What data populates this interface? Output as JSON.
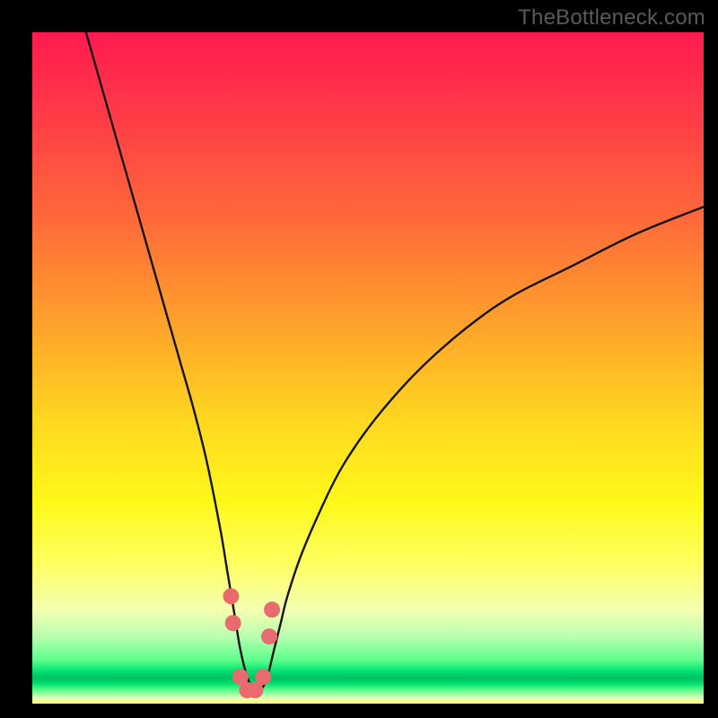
{
  "watermark": "TheBottleneck.com",
  "chart_data": {
    "type": "line",
    "title": "",
    "xlabel": "",
    "ylabel": "",
    "xlim": [
      0,
      100
    ],
    "ylim": [
      0,
      100
    ],
    "series": [
      {
        "name": "bottleneck-curve",
        "x": [
          8,
          10,
          12,
          14,
          16,
          18,
          20,
          22,
          24,
          26,
          28,
          29,
          30,
          31,
          32,
          33,
          34,
          35,
          36,
          37,
          38,
          40,
          43,
          46,
          50,
          55,
          60,
          66,
          72,
          80,
          90,
          100
        ],
        "y": [
          100,
          93,
          86,
          79,
          72,
          65,
          58,
          51,
          44,
          36,
          26,
          20,
          14,
          8,
          4,
          2,
          2,
          4,
          8,
          12,
          16,
          22,
          29,
          35,
          41,
          47,
          52,
          57,
          61,
          65,
          70,
          74
        ]
      }
    ],
    "markers": {
      "name": "highlight-dots",
      "color": "#e96a6f",
      "points_x": [
        29.6,
        29.9,
        31.0,
        32.0,
        33.2,
        34.4,
        35.3,
        35.7
      ],
      "points_y": [
        16,
        12,
        4,
        2,
        2,
        4,
        10,
        14
      ]
    },
    "annotations": []
  }
}
